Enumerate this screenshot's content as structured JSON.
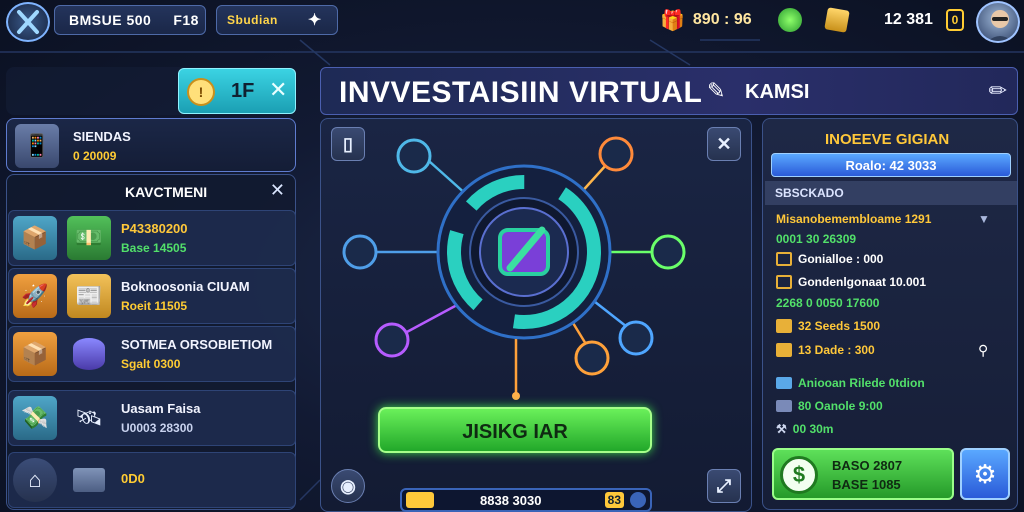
{
  "topbar": {
    "pill1_a": "BMSUE 500",
    "pill1_b": "F18",
    "pill2": "Sbudian",
    "res1": "890 : 96",
    "res2": "12 381",
    "res2_tag": "0"
  },
  "left": {
    "tab_value": "1F",
    "stat_title": "SIENDAS",
    "stat_value": "0 20009",
    "header": "KAVCTMENI",
    "items": [
      {
        "t1": "P43380200",
        "t2": "Base 14505"
      },
      {
        "t1": "Boknoosonia CIUAM",
        "t2": "Roeit 11505"
      },
      {
        "t1": "SOTMEA ORSOBIETIOM",
        "t2": "Sgalt 0300"
      },
      {
        "t1": "Uasam Faisa",
        "t2": "U0003 28300"
      },
      {
        "t1": "",
        "t2": "0D0"
      }
    ]
  },
  "main": {
    "title": "INVVESTAISIIN VIRTUAL",
    "subtitle": "KAMSI",
    "button": "JISIKG IAR",
    "bottom_value": "8838 3030",
    "bottom_badge": "83"
  },
  "right": {
    "header": "INOEEVE GIGIAN",
    "bar_text": "Roalo: 42 3033",
    "section": "SBSCKADO",
    "rows": [
      {
        "text": "Misanobemembloame 1291",
        "color": "gold"
      },
      {
        "text": "0001 30 26309",
        "color": "green"
      },
      {
        "text": "Gonialloe : 000",
        "color": "white"
      },
      {
        "text": "Gondenlgonaat 10.001",
        "color": "white"
      },
      {
        "text": "2268 0 0050 17600",
        "color": "green"
      },
      {
        "text": "32 Seeds 1500",
        "color": "gold"
      },
      {
        "text": "13 Dade : 300",
        "color": "gold"
      },
      {
        "text": "Aniooan Rilede 0tdion",
        "color": "green"
      },
      {
        "text": "80 Oanole 9:00",
        "color": "green"
      },
      {
        "text": "00 30m",
        "color": "green"
      }
    ],
    "cta_line1": "BASO 2807",
    "cta_line2": "BASE 1085"
  },
  "colors": {
    "accent_green": "#3fdc4a",
    "accent_cyan": "#39d0e0",
    "panel": "#18223f"
  }
}
